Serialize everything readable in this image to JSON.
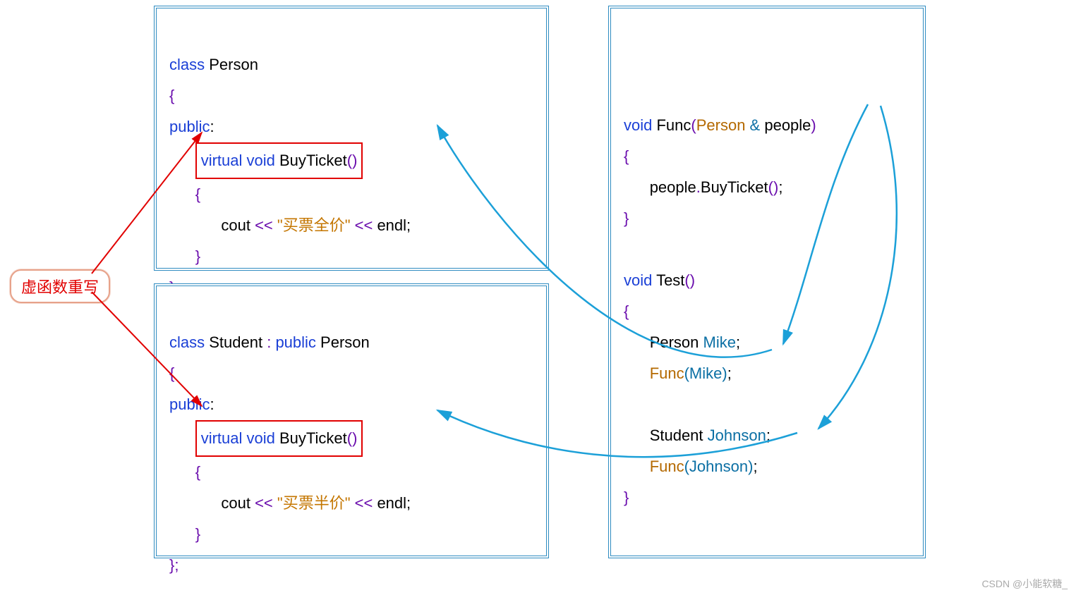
{
  "label": {
    "text": "虚函数重写"
  },
  "panel1": {
    "l1_class": "class",
    "l1_name": " Person",
    "brace_open": "{",
    "public": "public",
    "box_virtual": "virtual",
    "box_void": " void",
    "box_fn": " BuyTicket",
    "box_paren": "()",
    "inner_open": "{",
    "cout": "cout ",
    "lt1": "<<",
    "str": " \"买票全价\" ",
    "lt2": "<<",
    "endl": " endl",
    "semi": ";",
    "inner_close": "}",
    "brace_close": "};"
  },
  "panel2": {
    "l1_class": "class",
    "l1_name": " Student ",
    "colon": ":",
    "l1_public": " public",
    "l1_base": " Person",
    "brace_open": "{",
    "public": "public",
    "box_virtual": "virtual",
    "box_void": " void",
    "box_fn": " BuyTicket",
    "box_paren": "()",
    "inner_open": "{",
    "cout": "cout ",
    "lt1": "<<",
    "str": " \"买票半价\" ",
    "lt2": "<<",
    "endl": " endl",
    "semi": ";",
    "inner_close": "}",
    "brace_close": "};"
  },
  "panel3": {
    "void1": "void",
    "func1": " Func",
    "p_open": "(",
    "ptype": "Person",
    "amp": " &",
    "pname": " people",
    "p_close": ")",
    "b1": "{",
    "call_people": "people",
    "call_dot": ".",
    "call_fn": "BuyTicket",
    "call_par": "()",
    "call_semi": ";",
    "b2": "}",
    "void2": "void",
    "test": " Test",
    "test_par": "()",
    "t_b1": "{",
    "p_decl_type": "Person ",
    "p_decl_name": "Mike",
    "p_decl_semi": ";",
    "f1": "Func",
    "f1_arg": "(Mike)",
    "f1_semi": ";",
    "s_decl_type": "Student ",
    "s_decl_name": "Johnson",
    "s_decl_semi": ";",
    "f2": "Func",
    "f2_arg": "(Johnson)",
    "f2_semi": ";",
    "t_b2": "}"
  },
  "watermark": "CSDN @小能软糖_"
}
